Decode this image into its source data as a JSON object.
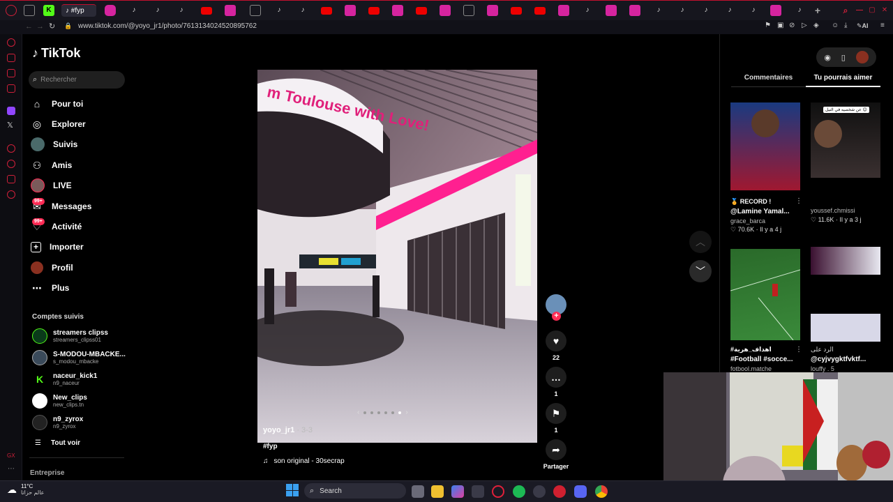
{
  "browser": {
    "active_tab_label": "#fyp",
    "url": "www.tiktok.com/@yoyo_jr1/photo/7613134024520895762",
    "ai_label": "AI"
  },
  "sidebar": {
    "logo": "TikTok",
    "search_placeholder": "Rechercher",
    "nav": [
      {
        "label": "Pour toi",
        "icon": "home-icon"
      },
      {
        "label": "Explorer",
        "icon": "compass-icon"
      },
      {
        "label": "Suivis",
        "icon": "following-avatar-icon"
      },
      {
        "label": "Amis",
        "icon": "friends-icon"
      },
      {
        "label": "LIVE",
        "icon": "live-avatar-icon"
      },
      {
        "label": "Messages",
        "icon": "messages-icon",
        "badge": "99+"
      },
      {
        "label": "Activité",
        "icon": "activity-icon",
        "badge": "99+"
      },
      {
        "label": "Importer",
        "icon": "upload-icon"
      },
      {
        "label": "Profil",
        "icon": "profile-icon"
      },
      {
        "label": "Plus",
        "icon": "more-icon"
      }
    ],
    "followed_title": "Comptes suivis",
    "accounts": [
      {
        "name": "streamers clipss",
        "handle": "streamers_clipss01"
      },
      {
        "name": "S-MODOU-MBACKE...",
        "handle": "s_modou_mbacke"
      },
      {
        "name": "naceur_kick1",
        "handle": "n9_naceur"
      },
      {
        "name": "New_clips",
        "handle": "new_clips.tn"
      },
      {
        "name": "n9_zyrox",
        "handle": "n9_zyrox"
      }
    ],
    "see_all": "Tout voir",
    "enterprise": "Entreprise"
  },
  "post": {
    "author": "yoyo_jr1",
    "page_indicator": "3-3",
    "hashtag": "#fyp",
    "sound": "son original - 30secrap",
    "photo_sign_text": "m Toulouse with Love!",
    "likes": "22",
    "comments": "1",
    "saves": "1",
    "share_label": "Partager"
  },
  "right_panel": {
    "tabs": [
      "Commentaires",
      "Tu pourrais aimer"
    ],
    "cards": [
      {
        "line1": "🏅 RECORD !",
        "line2": "@Lamine Yamal...",
        "author": "grace_barca",
        "likes": "70.6K",
        "time": "Il y a 4 j"
      },
      {
        "line1": "",
        "line2": "",
        "author": "youssef.chmissi",
        "likes": "11.6K",
        "time": "Il y a 3 j",
        "overlay": "عن شخصيه في النيل 😊"
      },
      {
        "line1": "#اهداف_هرية",
        "line2": "#Football #socce...",
        "author": "fotbool.matche",
        "likes": "",
        "time": ""
      },
      {
        "line1": "الرد على",
        "line2": "@cyjvygktfvktf...",
        "author": "louffy . 5",
        "likes": "",
        "time": ""
      }
    ]
  },
  "taskbar": {
    "weather_temp": "11°C",
    "weather_text": "عالم حزاتا",
    "search_label": "Search"
  },
  "colors": {
    "accent": "#fe2c55",
    "browser_accent": "#c2102e"
  }
}
